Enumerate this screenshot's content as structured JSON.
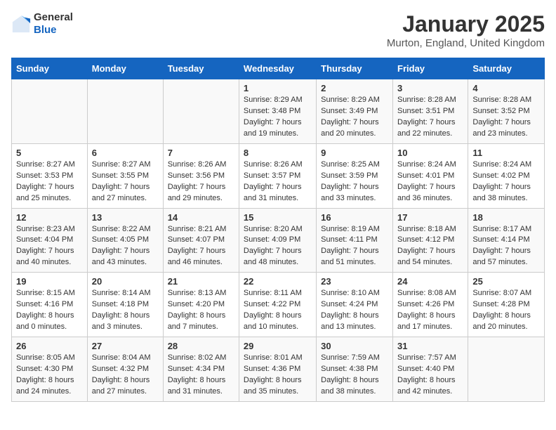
{
  "logo": {
    "general": "General",
    "blue": "Blue"
  },
  "title": "January 2025",
  "location": "Murton, England, United Kingdom",
  "days_of_week": [
    "Sunday",
    "Monday",
    "Tuesday",
    "Wednesday",
    "Thursday",
    "Friday",
    "Saturday"
  ],
  "weeks": [
    [
      {
        "day": "",
        "content": ""
      },
      {
        "day": "",
        "content": ""
      },
      {
        "day": "",
        "content": ""
      },
      {
        "day": "1",
        "content": "Sunrise: 8:29 AM\nSunset: 3:48 PM\nDaylight: 7 hours\nand 19 minutes."
      },
      {
        "day": "2",
        "content": "Sunrise: 8:29 AM\nSunset: 3:49 PM\nDaylight: 7 hours\nand 20 minutes."
      },
      {
        "day": "3",
        "content": "Sunrise: 8:28 AM\nSunset: 3:51 PM\nDaylight: 7 hours\nand 22 minutes."
      },
      {
        "day": "4",
        "content": "Sunrise: 8:28 AM\nSunset: 3:52 PM\nDaylight: 7 hours\nand 23 minutes."
      }
    ],
    [
      {
        "day": "5",
        "content": "Sunrise: 8:27 AM\nSunset: 3:53 PM\nDaylight: 7 hours\nand 25 minutes."
      },
      {
        "day": "6",
        "content": "Sunrise: 8:27 AM\nSunset: 3:55 PM\nDaylight: 7 hours\nand 27 minutes."
      },
      {
        "day": "7",
        "content": "Sunrise: 8:26 AM\nSunset: 3:56 PM\nDaylight: 7 hours\nand 29 minutes."
      },
      {
        "day": "8",
        "content": "Sunrise: 8:26 AM\nSunset: 3:57 PM\nDaylight: 7 hours\nand 31 minutes."
      },
      {
        "day": "9",
        "content": "Sunrise: 8:25 AM\nSunset: 3:59 PM\nDaylight: 7 hours\nand 33 minutes."
      },
      {
        "day": "10",
        "content": "Sunrise: 8:24 AM\nSunset: 4:01 PM\nDaylight: 7 hours\nand 36 minutes."
      },
      {
        "day": "11",
        "content": "Sunrise: 8:24 AM\nSunset: 4:02 PM\nDaylight: 7 hours\nand 38 minutes."
      }
    ],
    [
      {
        "day": "12",
        "content": "Sunrise: 8:23 AM\nSunset: 4:04 PM\nDaylight: 7 hours\nand 40 minutes."
      },
      {
        "day": "13",
        "content": "Sunrise: 8:22 AM\nSunset: 4:05 PM\nDaylight: 7 hours\nand 43 minutes."
      },
      {
        "day": "14",
        "content": "Sunrise: 8:21 AM\nSunset: 4:07 PM\nDaylight: 7 hours\nand 46 minutes."
      },
      {
        "day": "15",
        "content": "Sunrise: 8:20 AM\nSunset: 4:09 PM\nDaylight: 7 hours\nand 48 minutes."
      },
      {
        "day": "16",
        "content": "Sunrise: 8:19 AM\nSunset: 4:11 PM\nDaylight: 7 hours\nand 51 minutes."
      },
      {
        "day": "17",
        "content": "Sunrise: 8:18 AM\nSunset: 4:12 PM\nDaylight: 7 hours\nand 54 minutes."
      },
      {
        "day": "18",
        "content": "Sunrise: 8:17 AM\nSunset: 4:14 PM\nDaylight: 7 hours\nand 57 minutes."
      }
    ],
    [
      {
        "day": "19",
        "content": "Sunrise: 8:15 AM\nSunset: 4:16 PM\nDaylight: 8 hours\nand 0 minutes."
      },
      {
        "day": "20",
        "content": "Sunrise: 8:14 AM\nSunset: 4:18 PM\nDaylight: 8 hours\nand 3 minutes."
      },
      {
        "day": "21",
        "content": "Sunrise: 8:13 AM\nSunset: 4:20 PM\nDaylight: 8 hours\nand 7 minutes."
      },
      {
        "day": "22",
        "content": "Sunrise: 8:11 AM\nSunset: 4:22 PM\nDaylight: 8 hours\nand 10 minutes."
      },
      {
        "day": "23",
        "content": "Sunrise: 8:10 AM\nSunset: 4:24 PM\nDaylight: 8 hours\nand 13 minutes."
      },
      {
        "day": "24",
        "content": "Sunrise: 8:08 AM\nSunset: 4:26 PM\nDaylight: 8 hours\nand 17 minutes."
      },
      {
        "day": "25",
        "content": "Sunrise: 8:07 AM\nSunset: 4:28 PM\nDaylight: 8 hours\nand 20 minutes."
      }
    ],
    [
      {
        "day": "26",
        "content": "Sunrise: 8:05 AM\nSunset: 4:30 PM\nDaylight: 8 hours\nand 24 minutes."
      },
      {
        "day": "27",
        "content": "Sunrise: 8:04 AM\nSunset: 4:32 PM\nDaylight: 8 hours\nand 27 minutes."
      },
      {
        "day": "28",
        "content": "Sunrise: 8:02 AM\nSunset: 4:34 PM\nDaylight: 8 hours\nand 31 minutes."
      },
      {
        "day": "29",
        "content": "Sunrise: 8:01 AM\nSunset: 4:36 PM\nDaylight: 8 hours\nand 35 minutes."
      },
      {
        "day": "30",
        "content": "Sunrise: 7:59 AM\nSunset: 4:38 PM\nDaylight: 8 hours\nand 38 minutes."
      },
      {
        "day": "31",
        "content": "Sunrise: 7:57 AM\nSunset: 4:40 PM\nDaylight: 8 hours\nand 42 minutes."
      },
      {
        "day": "",
        "content": ""
      }
    ]
  ]
}
